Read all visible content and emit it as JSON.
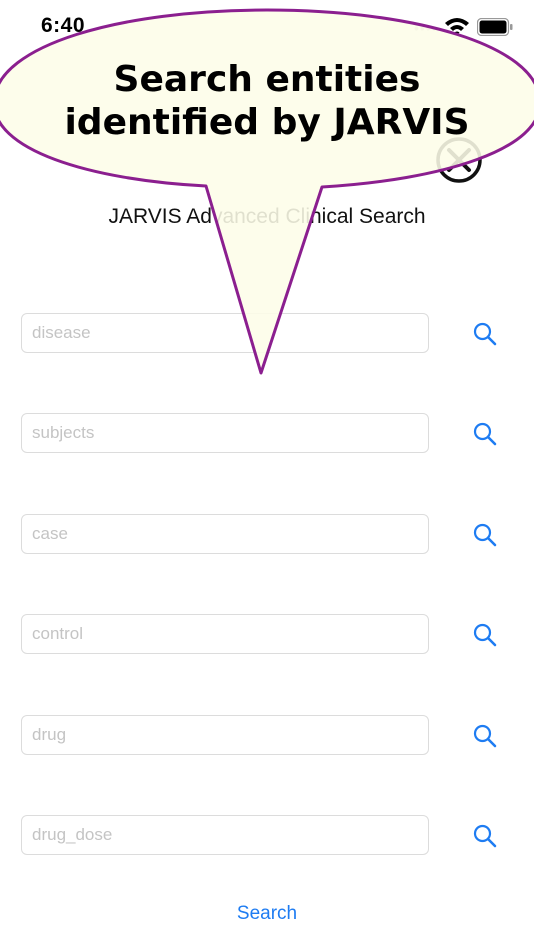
{
  "status_bar": {
    "time": "6:40",
    "dots": "••••"
  },
  "page": {
    "title": "JARVIS Advanced Clinical Search"
  },
  "fields": [
    {
      "placeholder": "disease"
    },
    {
      "placeholder": "subjects"
    },
    {
      "placeholder": "case"
    },
    {
      "placeholder": "control"
    },
    {
      "placeholder": "drug"
    },
    {
      "placeholder": "drug_dose"
    }
  ],
  "search_button": {
    "label": "Search"
  },
  "tooltip": {
    "line1": "Search entities",
    "line2": "identified by JARVIS"
  },
  "colors": {
    "accent": "#1e7cf2",
    "tooltip_fill": "#fdfde8",
    "tooltip_border": "#8b1f8f"
  },
  "icons": {
    "close": "close-icon",
    "search": "search-icon",
    "wifi": "wifi-icon",
    "battery": "battery-icon"
  }
}
